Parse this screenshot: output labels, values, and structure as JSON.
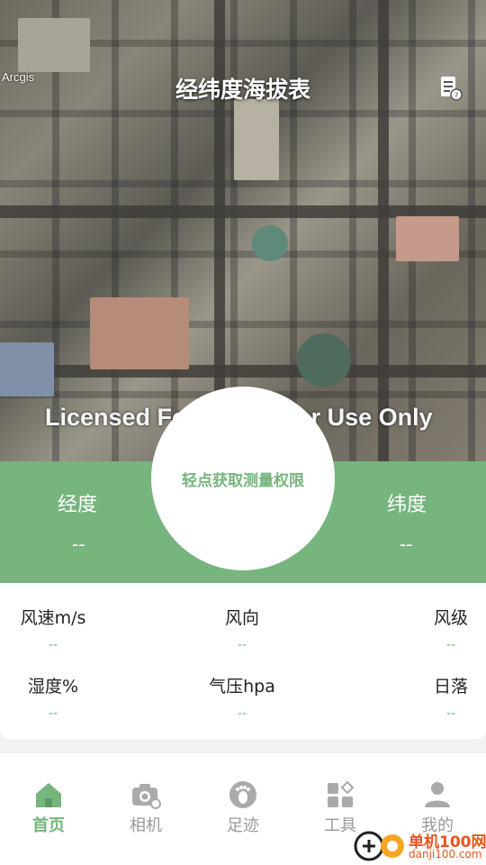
{
  "header": {
    "title": "经纬度海拔表",
    "map_attribution": "Arcgis",
    "doc_icon": "document-help-icon"
  },
  "map": {
    "watermark": "Licensed For Developer Use Only"
  },
  "measure": {
    "button_label": "轻点获取测量权限",
    "longitude_label": "经度",
    "longitude_value": "--",
    "latitude_label": "纬度",
    "latitude_value": "--"
  },
  "weather": {
    "items": [
      {
        "label": "风速m/s",
        "value": "--"
      },
      {
        "label": "风向",
        "value": "--"
      },
      {
        "label": "风级",
        "value": "--"
      },
      {
        "label": "湿度%",
        "value": "--"
      },
      {
        "label": "气压hpa",
        "value": "--"
      },
      {
        "label": "日落",
        "value": "--"
      }
    ]
  },
  "tabs": [
    {
      "label": "首页",
      "icon": "home-icon",
      "active": true
    },
    {
      "label": "相机",
      "icon": "camera-icon",
      "active": false
    },
    {
      "label": "足迹",
      "icon": "footprint-icon",
      "active": false
    },
    {
      "label": "工具",
      "icon": "tools-icon",
      "active": false
    },
    {
      "label": "我的",
      "icon": "user-icon",
      "active": false
    }
  ],
  "watermark_logo": {
    "text": "单机100网",
    "url": "danji100.com"
  },
  "colors": {
    "accent": "#76b57d",
    "inactive": "#9a9a9a",
    "logo": "#e8541e"
  }
}
